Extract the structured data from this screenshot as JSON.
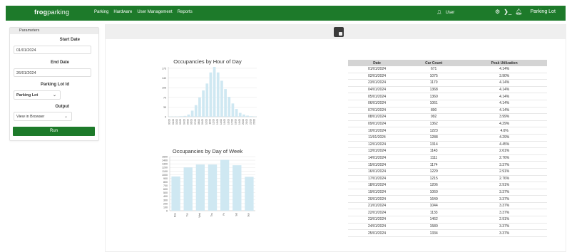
{
  "brand": {
    "logo_bold": "frog",
    "logo_rest": "parking"
  },
  "nav": [
    {
      "label": "Parking"
    },
    {
      "label": "Hardware"
    },
    {
      "label": "User Management"
    },
    {
      "label": "Reports"
    }
  ],
  "user": {
    "label": "User"
  },
  "header_right": {
    "lot_label": "Parking Lot"
  },
  "params": {
    "title": "Parameters",
    "start_label": "Start Date",
    "start_value": "01/01/2024",
    "end_label": "End Date",
    "end_value": "26/01/2024",
    "lot_label": "Parking Lot Id",
    "lot_value": "Parking Lot",
    "output_label": "Output",
    "output_value": "View in Browser",
    "run_label": "Run"
  },
  "charts": {
    "hour_title": "Occupancies by Hour of Day",
    "week_title": "Occupancies by Day of Week"
  },
  "chart_data": [
    {
      "type": "bar",
      "title": "Occupancies by Hour of Day",
      "categories": [
        "00:00",
        "01:00",
        "02:00",
        "03:00",
        "04:00",
        "05:00",
        "06:00",
        "07:00",
        "08:00",
        "09:00",
        "10:00",
        "11:00",
        "12:00",
        "13:00",
        "14:00",
        "15:00",
        "16:00",
        "17:00",
        "18:00",
        "19:00",
        "20:00",
        "21:00",
        "22:00",
        "23:00"
      ],
      "values": [
        1,
        1,
        1,
        2,
        3,
        8,
        22,
        42,
        70,
        95,
        120,
        160,
        180,
        160,
        130,
        100,
        72,
        48,
        28,
        14,
        8,
        4,
        2,
        1
      ],
      "yticks": [
        0,
        35,
        70,
        105,
        140,
        175
      ],
      "ylim": [
        0,
        180
      ],
      "color": "#cfe8f2"
    },
    {
      "type": "bar",
      "title": "Occupancies by Day of Week",
      "categories": [
        "Mon",
        "Tue",
        "Wed",
        "Thu",
        "Fri",
        "Sat",
        "Sun"
      ],
      "values": [
        950,
        1200,
        1280,
        1280,
        1410,
        1260,
        940
      ],
      "yticks": [
        0,
        100,
        200,
        300,
        400,
        500,
        600,
        700,
        800,
        900,
        1000,
        1100,
        1200,
        1300,
        1400,
        1500
      ],
      "ylim": [
        0,
        1500
      ],
      "color": "#cfe8f2"
    }
  ],
  "table": {
    "headers": [
      "Date",
      "Car Count",
      "Peak Utilization"
    ],
    "rows": [
      [
        "01/01/2024",
        "671",
        "4.14%"
      ],
      [
        "02/01/2024",
        "1075",
        "3.90%"
      ],
      [
        "23/01/2024",
        "1170",
        "4.14%"
      ],
      [
        "04/01/2024",
        "1368",
        "4.14%"
      ],
      [
        "05/01/2024",
        "1360",
        "4.14%"
      ],
      [
        "06/01/2024",
        "1061",
        "4.14%"
      ],
      [
        "07/01/2024",
        "800",
        "4.14%"
      ],
      [
        "08/01/2024",
        "992",
        "3.99%"
      ],
      [
        "09/01/2024",
        "1362",
        "4.29%"
      ],
      [
        "10/01/2024",
        "1223",
        "4.6%"
      ],
      [
        "11/01/2024",
        "1288",
        "4.29%"
      ],
      [
        "12/01/2024",
        "1314",
        "4.45%"
      ],
      [
        "13/01/2024",
        "1143",
        "2.61%"
      ],
      [
        "14/01/2024",
        "1111",
        "2.76%"
      ],
      [
        "15/01/2024",
        "1174",
        "3.37%"
      ],
      [
        "16/01/2024",
        "1229",
        "2.91%"
      ],
      [
        "17/01/2024",
        "1215",
        "2.76%"
      ],
      [
        "18/01/2024",
        "1206",
        "2.91%"
      ],
      [
        "19/01/2024",
        "1060",
        "3.37%"
      ],
      [
        "20/01/2024",
        "1649",
        "3.37%"
      ],
      [
        "21/01/2024",
        "1044",
        "3.37%"
      ],
      [
        "22/01/2024",
        "1133",
        "3.37%"
      ],
      [
        "23/01/2024",
        "1462",
        "2.91%"
      ],
      [
        "24/01/2024",
        "1580",
        "3.37%"
      ],
      [
        "25/01/2024",
        "1334",
        "3.37%"
      ]
    ]
  }
}
